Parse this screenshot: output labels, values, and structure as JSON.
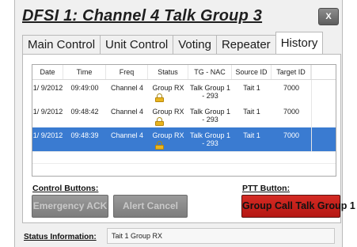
{
  "window": {
    "title": "DFSI 1: Channel 4 Talk Group 3",
    "close_label": "X"
  },
  "tabs": [
    {
      "label": "Main Control"
    },
    {
      "label": "Unit Control"
    },
    {
      "label": "Voting"
    },
    {
      "label": "Repeater"
    },
    {
      "label": "History",
      "active": true
    }
  ],
  "history": {
    "columns": [
      "Date",
      "Time",
      "Freq",
      "Status",
      "TG - NAC",
      "Source ID",
      "Target ID"
    ],
    "rows": [
      {
        "date": "1/ 9/2012",
        "time": "09:49:00",
        "freq": "Channel 4",
        "status": "Group RX",
        "tg_nac": "Talk Group 1 - 293",
        "source_id": "Tait 1",
        "target_id": "7000",
        "status_icon": "lock-icon",
        "selected": false
      },
      {
        "date": "1/ 9/2012",
        "time": "09:48:42",
        "freq": "Channel 4",
        "status": "Group RX",
        "tg_nac": "Talk Group 1 - 293",
        "source_id": "Tait 1",
        "target_id": "7000",
        "status_icon": "lock-icon",
        "selected": false
      },
      {
        "date": "1/ 9/2012",
        "time": "09:48:39",
        "freq": "Channel 4",
        "status": "Group RX",
        "tg_nac": "Talk Group 1 - 293",
        "source_id": "Tait 1",
        "target_id": "7000",
        "status_icon": "lock-icon",
        "selected": true
      }
    ]
  },
  "controls": {
    "label": "Control Buttons:",
    "emergency_ack": "Emergency ACK",
    "alert_cancel": "Alert Cancel"
  },
  "ptt": {
    "label": "PTT Button:",
    "button": "Group Call Talk Group 1",
    "button_color": "#c8201a"
  },
  "status": {
    "label": "Status Information:",
    "value": "Tait 1 Group RX"
  },
  "colors": {
    "selection": "#3a7bd1",
    "background": "#f0f0f0"
  }
}
